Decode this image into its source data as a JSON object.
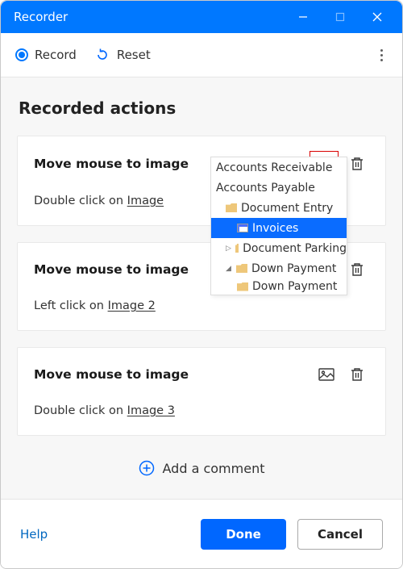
{
  "window": {
    "title": "Recorder"
  },
  "toolbar": {
    "record": "Record",
    "reset": "Reset"
  },
  "heading": "Recorded actions",
  "actions": [
    {
      "title": "Move mouse to image",
      "desc_prefix": "Double click on  ",
      "link": "Image"
    },
    {
      "title": "Move mouse to image",
      "desc_prefix": "Left click on  ",
      "link": "Image  2"
    },
    {
      "title": "Move mouse to image",
      "desc_prefix": "Double click on  ",
      "link": "Image  3"
    }
  ],
  "add_comment": "Add a comment",
  "footer": {
    "help": "Help",
    "done": "Done",
    "cancel": "Cancel"
  },
  "tree": {
    "items": [
      "Accounts Receivable",
      "Accounts Payable",
      "Document Entry",
      "Invoices",
      "Document Parking",
      "Down Payment",
      "Down Payment"
    ]
  }
}
